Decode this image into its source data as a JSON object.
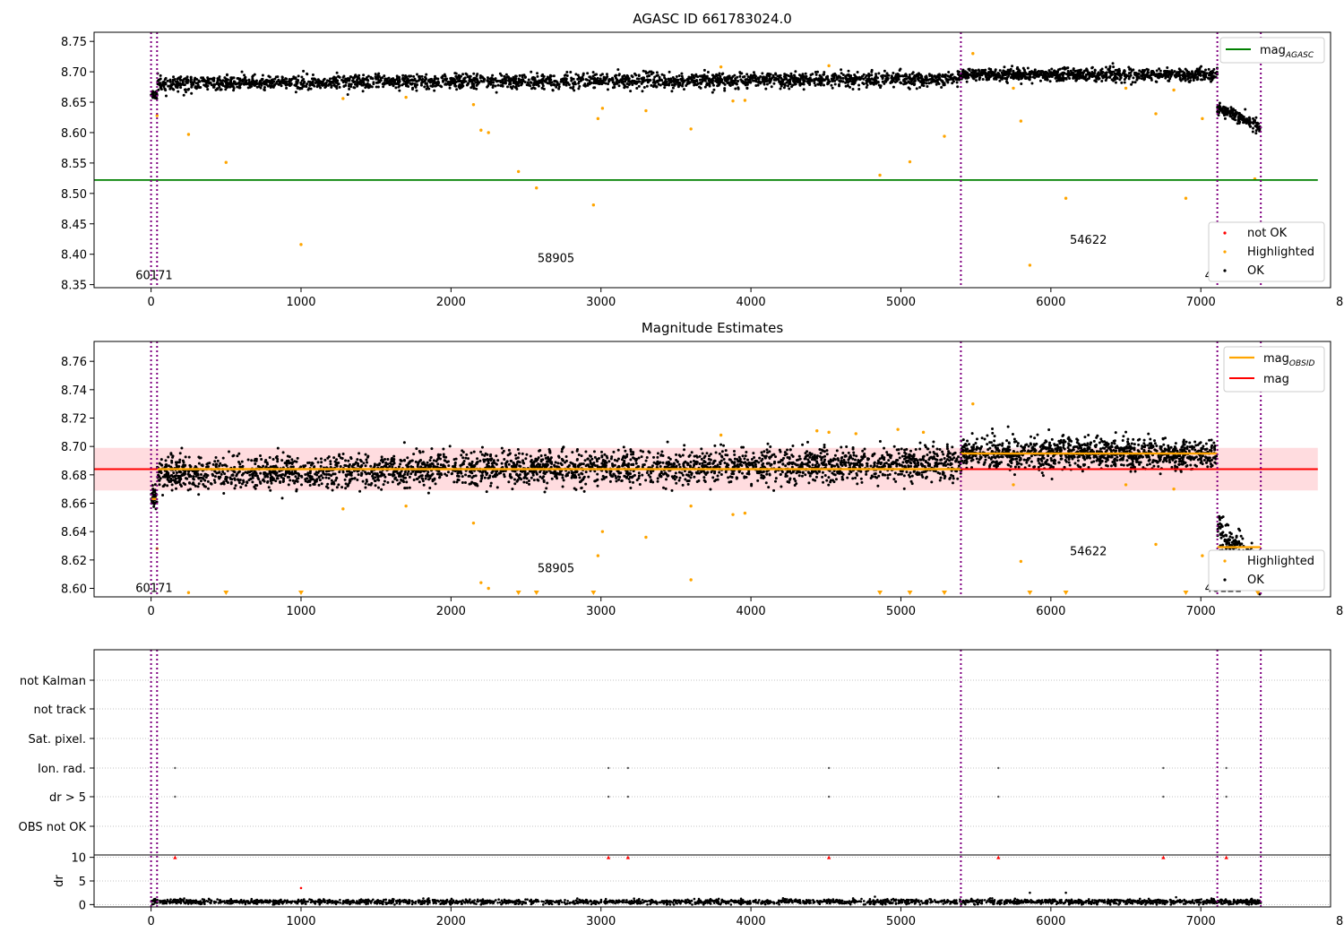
{
  "chart_data": [
    {
      "type": "scatter",
      "title": "AGASC ID 661783024.0",
      "xlim": [
        -380,
        7865
      ],
      "ylim": [
        8.345,
        8.765
      ],
      "x_ticks": [
        0,
        1000,
        2000,
        3000,
        4000,
        5000,
        6000,
        7000,
        8000
      ],
      "y_ticks": [
        8.35,
        8.4,
        8.45,
        8.5,
        8.55,
        8.6,
        8.65,
        8.7,
        8.75
      ],
      "reference_lines": [
        {
          "name": "mag_AGASC",
          "y": 8.522,
          "x_range": [
            -380,
            7780
          ],
          "color": "#008000"
        }
      ],
      "obsid_boundaries": [
        0,
        40,
        5400,
        7110,
        7400
      ],
      "obsid_labels": [
        {
          "text": "60171",
          "x": 20,
          "y": 8.365
        },
        {
          "text": "58905",
          "x": 2700,
          "y": 8.393
        },
        {
          "text": "54622",
          "x": 6250,
          "y": 8.423
        },
        {
          "text": "48121",
          "x": 7150,
          "y": 8.365
        }
      ],
      "ok_segments": [
        {
          "x_range": [
            0,
            40
          ],
          "base": 8.663,
          "spread": 0.012
        },
        {
          "x_range": [
            40,
            5400
          ],
          "base_start": 8.681,
          "base_end": 8.688,
          "spread": 0.018
        },
        {
          "x_range": [
            5400,
            7110
          ],
          "base": 8.695,
          "spread": 0.016
        },
        {
          "x_range": [
            7110,
            7400
          ],
          "base_start": 8.64,
          "base_end": 8.61,
          "spread": 0.014
        }
      ],
      "highlighted": [
        [
          40,
          8.628
        ],
        [
          250,
          8.597
        ],
        [
          500,
          8.551
        ],
        [
          1000,
          8.416
        ],
        [
          1280,
          8.656
        ],
        [
          1700,
          8.658
        ],
        [
          2150,
          8.646
        ],
        [
          2200,
          8.604
        ],
        [
          2250,
          8.6
        ],
        [
          2450,
          8.536
        ],
        [
          2570,
          8.509
        ],
        [
          2950,
          8.481
        ],
        [
          2980,
          8.623
        ],
        [
          3010,
          8.64
        ],
        [
          3300,
          8.636
        ],
        [
          3600,
          8.606
        ],
        [
          3800,
          8.708
        ],
        [
          3880,
          8.652
        ],
        [
          3960,
          8.653
        ],
        [
          4520,
          8.71
        ],
        [
          4860,
          8.53
        ],
        [
          5060,
          8.552
        ],
        [
          5290,
          8.594
        ],
        [
          5480,
          8.73
        ],
        [
          5750,
          8.673
        ],
        [
          5800,
          8.619
        ],
        [
          5860,
          8.382
        ],
        [
          6100,
          8.492
        ],
        [
          6500,
          8.673
        ],
        [
          6700,
          8.631
        ],
        [
          6820,
          8.67
        ],
        [
          6900,
          8.492
        ],
        [
          7010,
          8.623
        ],
        [
          7360,
          8.524
        ]
      ],
      "legend": {
        "upper_right": [
          "mag_AGASC"
        ],
        "lower_right": [
          "not OK",
          "Highlighted",
          "OK"
        ]
      },
      "series_colors": {
        "OK": "#000000",
        "Highlighted": "#ffa500",
        "not OK": "#ff0000"
      }
    },
    {
      "type": "scatter",
      "title": "Magnitude Estimates",
      "xlim": [
        -380,
        7865
      ],
      "ylim": [
        8.594,
        8.774
      ],
      "x_ticks": [
        0,
        1000,
        2000,
        3000,
        4000,
        5000,
        6000,
        7000,
        8000
      ],
      "y_ticks": [
        8.6,
        8.62,
        8.64,
        8.66,
        8.68,
        8.7,
        8.72,
        8.74,
        8.76
      ],
      "mag": 8.684,
      "mag_band": [
        8.669,
        8.699
      ],
      "mag_x_range": [
        -380,
        7780
      ],
      "mag_obsid": [
        {
          "x_range": [
            0,
            40
          ],
          "y": 8.663
        },
        {
          "x_range": [
            40,
            5400
          ],
          "y": 8.684
        },
        {
          "x_range": [
            5400,
            7110
          ],
          "y": 8.695
        },
        {
          "x_range": [
            7110,
            7400
          ],
          "y": 8.629
        }
      ],
      "obsid_labels": [
        {
          "text": "60171",
          "x": 20,
          "y": 8.6
        },
        {
          "text": "58905",
          "x": 2700,
          "y": 8.614
        },
        {
          "text": "54622",
          "x": 6250,
          "y": 8.626
        },
        {
          "text": "48121",
          "x": 7150,
          "y": 8.6
        }
      ],
      "highlighted": [
        [
          40,
          8.628
        ],
        [
          250,
          8.597
        ],
        [
          1280,
          8.656
        ],
        [
          1700,
          8.658
        ],
        [
          2150,
          8.646
        ],
        [
          2200,
          8.604
        ],
        [
          2250,
          8.6
        ],
        [
          2980,
          8.623
        ],
        [
          3010,
          8.64
        ],
        [
          3300,
          8.636
        ],
        [
          3600,
          8.606
        ],
        [
          3600,
          8.658
        ],
        [
          3800,
          8.708
        ],
        [
          3880,
          8.652
        ],
        [
          3960,
          8.653
        ],
        [
          4440,
          8.711
        ],
        [
          4520,
          8.71
        ],
        [
          4700,
          8.709
        ],
        [
          4980,
          8.712
        ],
        [
          5150,
          8.71
        ],
        [
          5480,
          8.73
        ],
        [
          5750,
          8.673
        ],
        [
          5800,
          8.619
        ],
        [
          6500,
          8.673
        ],
        [
          6700,
          8.631
        ],
        [
          6820,
          8.67
        ],
        [
          7010,
          8.623
        ]
      ],
      "below_range_markers": [
        500,
        1000,
        2450,
        2570,
        2950,
        4860,
        5060,
        5290,
        5860,
        6100,
        6900,
        7380
      ],
      "legend": {
        "upper_right": [
          "mag_OBSID",
          "mag"
        ],
        "lower_right": [
          "Highlighted",
          "OK"
        ]
      },
      "series_colors": {
        "mag_OBSID": "#ffa500",
        "mag": "#ff0000",
        "band": "#ffd6d9"
      }
    },
    {
      "type": "scatter",
      "title": "",
      "categories": [
        "not Kalman",
        "not track",
        "Sat. pixel.",
        "Ion. rad.",
        "dr > 5",
        "OBS not OK"
      ],
      "flag_x": [
        160,
        3050,
        3180,
        4520,
        5650,
        6750,
        7170
      ],
      "flagged_categories": [
        "Ion. rad.",
        "dr > 5"
      ],
      "dr_panel": {
        "ylabel": "dr",
        "y_ticks": [
          0,
          5,
          10
        ],
        "ylim": [
          -0.5,
          10.5
        ],
        "clipped_markers_x": [
          160,
          3050,
          3180,
          4520,
          5650,
          6750,
          7170
        ],
        "outliers": [
          [
            1000,
            3.5
          ],
          [
            5860,
            2.5
          ],
          [
            6100,
            2.5
          ]
        ],
        "baseline": 0.6
      },
      "xlim": [
        -380,
        7865
      ],
      "x_ticks": [
        0,
        1000,
        2000,
        3000,
        4000,
        5000,
        6000,
        7000,
        8000
      ]
    }
  ],
  "legend_labels": {
    "mag_agasc_main": "mag",
    "mag_agasc_sub": "AGASC",
    "not_ok": "not OK",
    "highlighted": "Highlighted",
    "ok": "OK",
    "mag_obsid_main": "mag",
    "mag_obsid_sub": "OBSID",
    "mag": "mag"
  }
}
